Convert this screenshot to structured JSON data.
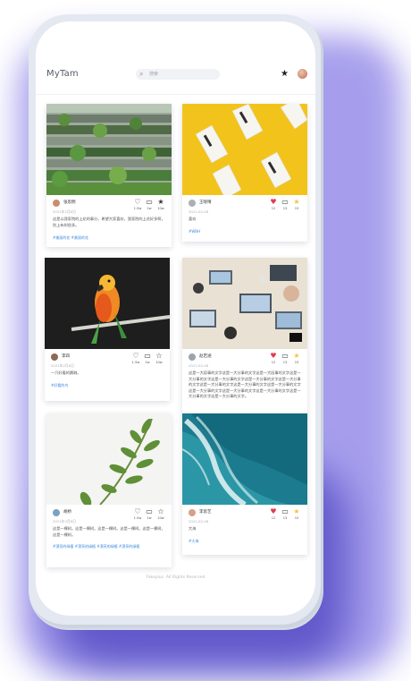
{
  "app": {
    "brand": "MyTam",
    "search_placeholder": "搜索",
    "footer": "Fakeplus. All Rights Reserved"
  },
  "icons": {
    "search": "search-icon",
    "star": "star-icon",
    "like": "heart-icon",
    "comment": "comment-icon",
    "favorite": "star-icon"
  },
  "colors": {
    "accent": "#3a8be0",
    "liked": "#e23b4e",
    "favorited": "#f6c343"
  },
  "posts": [
    {
      "user": "张思明",
      "date": "2021年2月8日",
      "text": "这是以我家院的上花的事分，希望大家喜欢，我家院的上花好多啊，别上有树很多。",
      "tags": "#美丽的花 #美丽的花",
      "likes": "1.5w",
      "comments": "1w",
      "favorites": "10w",
      "image": "building"
    },
    {
      "user": "王晓晴",
      "date": "2021-02-08",
      "text": "喜欢",
      "tags": "#WBH",
      "likes": "12",
      "comments": "13",
      "favorites": "15",
      "image": "boxed-water"
    },
    {
      "user": "李四",
      "date": "2021年2月8日",
      "text": "一只好看的鹦鹉。",
      "tags": "#好看的鸟",
      "likes": "1.5w",
      "comments": "1w",
      "favorites": "10w",
      "image": "parrot"
    },
    {
      "user": "赵若涵",
      "date": "2021-02-08",
      "text": "这是一大段事的文字这是一大分事的文字这是一大段事的文字这是一大分事的文字这是一大分事的文字这是一大分事的文字这是一大分事的文字这是一大分事的文字这是一大分事的文字这是一大分事的文字这是一大分事的文字这是一大分事的文字这是一大分事的文字这是一大分事的文字这是一大分事的文字。",
      "tags": "",
      "likes": "12",
      "comments": "13",
      "favorites": "15",
      "image": "office-desk"
    },
    {
      "user": "胡桥",
      "date": "2021年2月8日",
      "text": "这是一棵树。这是一棵树。这是一棵树。这是一棵树。这是一棵树。这是一棵树。",
      "tags": "#漂亮的绿植 #漂亮的绿植 #漂亮的绿植 #漂亮的绿植",
      "likes": "1.5w",
      "comments": "1w",
      "favorites": "10w",
      "image": "plant"
    },
    {
      "user": "李思艺",
      "date": "2021-02-08",
      "text": "大海",
      "tags": "#大海",
      "likes": "12",
      "comments": "13",
      "favorites": "15",
      "image": "ocean"
    }
  ]
}
